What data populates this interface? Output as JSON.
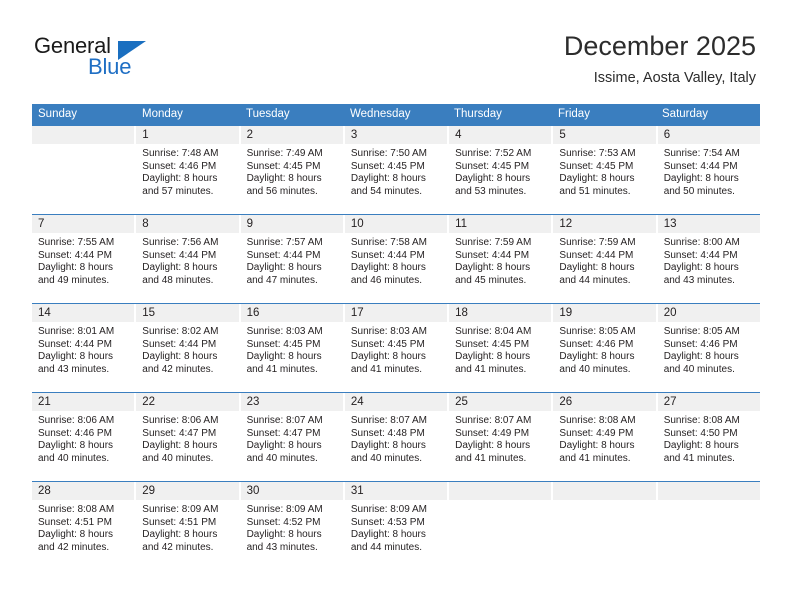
{
  "brand": {
    "name_top": "General",
    "name_bottom": "Blue",
    "flag_icon": "blue-triangle-flag-icon",
    "accent_color": "#1f6fc4"
  },
  "header": {
    "title": "December 2025",
    "subtitle": "Issime, Aosta Valley, Italy"
  },
  "theme": {
    "header_row_color": "#3a7ebf",
    "day_number_band_color": "#f0f0f0",
    "text_color": "#231f20"
  },
  "weekdays": [
    "Sunday",
    "Monday",
    "Tuesday",
    "Wednesday",
    "Thursday",
    "Friday",
    "Saturday"
  ],
  "weeks": [
    [
      {
        "day": "",
        "sunrise": "",
        "sunset": "",
        "daylight": ""
      },
      {
        "day": "1",
        "sunrise": "Sunrise: 7:48 AM",
        "sunset": "Sunset: 4:46 PM",
        "daylight": "Daylight: 8 hours and 57 minutes."
      },
      {
        "day": "2",
        "sunrise": "Sunrise: 7:49 AM",
        "sunset": "Sunset: 4:45 PM",
        "daylight": "Daylight: 8 hours and 56 minutes."
      },
      {
        "day": "3",
        "sunrise": "Sunrise: 7:50 AM",
        "sunset": "Sunset: 4:45 PM",
        "daylight": "Daylight: 8 hours and 54 minutes."
      },
      {
        "day": "4",
        "sunrise": "Sunrise: 7:52 AM",
        "sunset": "Sunset: 4:45 PM",
        "daylight": "Daylight: 8 hours and 53 minutes."
      },
      {
        "day": "5",
        "sunrise": "Sunrise: 7:53 AM",
        "sunset": "Sunset: 4:45 PM",
        "daylight": "Daylight: 8 hours and 51 minutes."
      },
      {
        "day": "6",
        "sunrise": "Sunrise: 7:54 AM",
        "sunset": "Sunset: 4:44 PM",
        "daylight": "Daylight: 8 hours and 50 minutes."
      }
    ],
    [
      {
        "day": "7",
        "sunrise": "Sunrise: 7:55 AM",
        "sunset": "Sunset: 4:44 PM",
        "daylight": "Daylight: 8 hours and 49 minutes."
      },
      {
        "day": "8",
        "sunrise": "Sunrise: 7:56 AM",
        "sunset": "Sunset: 4:44 PM",
        "daylight": "Daylight: 8 hours and 48 minutes."
      },
      {
        "day": "9",
        "sunrise": "Sunrise: 7:57 AM",
        "sunset": "Sunset: 4:44 PM",
        "daylight": "Daylight: 8 hours and 47 minutes."
      },
      {
        "day": "10",
        "sunrise": "Sunrise: 7:58 AM",
        "sunset": "Sunset: 4:44 PM",
        "daylight": "Daylight: 8 hours and 46 minutes."
      },
      {
        "day": "11",
        "sunrise": "Sunrise: 7:59 AM",
        "sunset": "Sunset: 4:44 PM",
        "daylight": "Daylight: 8 hours and 45 minutes."
      },
      {
        "day": "12",
        "sunrise": "Sunrise: 7:59 AM",
        "sunset": "Sunset: 4:44 PM",
        "daylight": "Daylight: 8 hours and 44 minutes."
      },
      {
        "day": "13",
        "sunrise": "Sunrise: 8:00 AM",
        "sunset": "Sunset: 4:44 PM",
        "daylight": "Daylight: 8 hours and 43 minutes."
      }
    ],
    [
      {
        "day": "14",
        "sunrise": "Sunrise: 8:01 AM",
        "sunset": "Sunset: 4:44 PM",
        "daylight": "Daylight: 8 hours and 43 minutes."
      },
      {
        "day": "15",
        "sunrise": "Sunrise: 8:02 AM",
        "sunset": "Sunset: 4:44 PM",
        "daylight": "Daylight: 8 hours and 42 minutes."
      },
      {
        "day": "16",
        "sunrise": "Sunrise: 8:03 AM",
        "sunset": "Sunset: 4:45 PM",
        "daylight": "Daylight: 8 hours and 41 minutes."
      },
      {
        "day": "17",
        "sunrise": "Sunrise: 8:03 AM",
        "sunset": "Sunset: 4:45 PM",
        "daylight": "Daylight: 8 hours and 41 minutes."
      },
      {
        "day": "18",
        "sunrise": "Sunrise: 8:04 AM",
        "sunset": "Sunset: 4:45 PM",
        "daylight": "Daylight: 8 hours and 41 minutes."
      },
      {
        "day": "19",
        "sunrise": "Sunrise: 8:05 AM",
        "sunset": "Sunset: 4:46 PM",
        "daylight": "Daylight: 8 hours and 40 minutes."
      },
      {
        "day": "20",
        "sunrise": "Sunrise: 8:05 AM",
        "sunset": "Sunset: 4:46 PM",
        "daylight": "Daylight: 8 hours and 40 minutes."
      }
    ],
    [
      {
        "day": "21",
        "sunrise": "Sunrise: 8:06 AM",
        "sunset": "Sunset: 4:46 PM",
        "daylight": "Daylight: 8 hours and 40 minutes."
      },
      {
        "day": "22",
        "sunrise": "Sunrise: 8:06 AM",
        "sunset": "Sunset: 4:47 PM",
        "daylight": "Daylight: 8 hours and 40 minutes."
      },
      {
        "day": "23",
        "sunrise": "Sunrise: 8:07 AM",
        "sunset": "Sunset: 4:47 PM",
        "daylight": "Daylight: 8 hours and 40 minutes."
      },
      {
        "day": "24",
        "sunrise": "Sunrise: 8:07 AM",
        "sunset": "Sunset: 4:48 PM",
        "daylight": "Daylight: 8 hours and 40 minutes."
      },
      {
        "day": "25",
        "sunrise": "Sunrise: 8:07 AM",
        "sunset": "Sunset: 4:49 PM",
        "daylight": "Daylight: 8 hours and 41 minutes."
      },
      {
        "day": "26",
        "sunrise": "Sunrise: 8:08 AM",
        "sunset": "Sunset: 4:49 PM",
        "daylight": "Daylight: 8 hours and 41 minutes."
      },
      {
        "day": "27",
        "sunrise": "Sunrise: 8:08 AM",
        "sunset": "Sunset: 4:50 PM",
        "daylight": "Daylight: 8 hours and 41 minutes."
      }
    ],
    [
      {
        "day": "28",
        "sunrise": "Sunrise: 8:08 AM",
        "sunset": "Sunset: 4:51 PM",
        "daylight": "Daylight: 8 hours and 42 minutes."
      },
      {
        "day": "29",
        "sunrise": "Sunrise: 8:09 AM",
        "sunset": "Sunset: 4:51 PM",
        "daylight": "Daylight: 8 hours and 42 minutes."
      },
      {
        "day": "30",
        "sunrise": "Sunrise: 8:09 AM",
        "sunset": "Sunset: 4:52 PM",
        "daylight": "Daylight: 8 hours and 43 minutes."
      },
      {
        "day": "31",
        "sunrise": "Sunrise: 8:09 AM",
        "sunset": "Sunset: 4:53 PM",
        "daylight": "Daylight: 8 hours and 44 minutes."
      },
      {
        "day": "",
        "sunrise": "",
        "sunset": "",
        "daylight": ""
      },
      {
        "day": "",
        "sunrise": "",
        "sunset": "",
        "daylight": ""
      },
      {
        "day": "",
        "sunrise": "",
        "sunset": "",
        "daylight": ""
      }
    ]
  ]
}
